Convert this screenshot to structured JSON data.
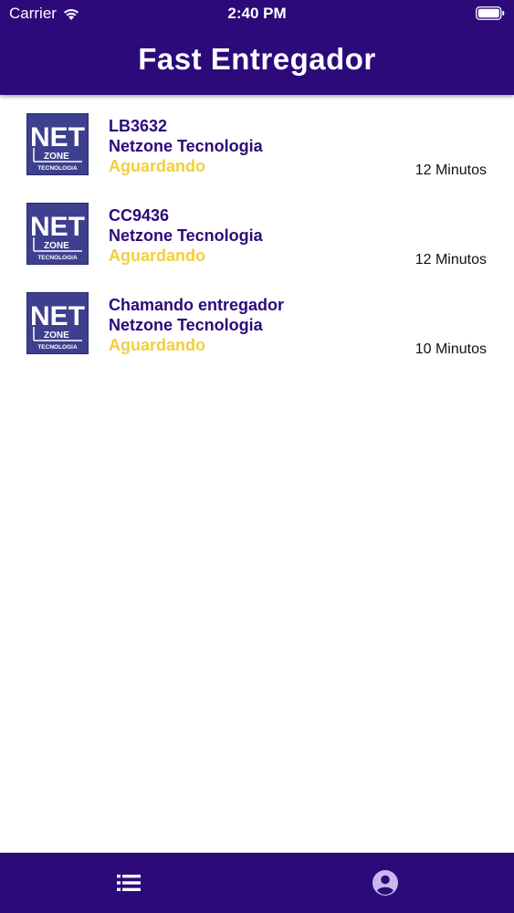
{
  "status_bar": {
    "carrier": "Carrier",
    "time": "2:40 PM"
  },
  "header": {
    "title": "Fast Entregador"
  },
  "orders": [
    {
      "code": "LB3632",
      "company": "Netzone Tecnologia",
      "status": "Aguardando",
      "time": "12 Minutos",
      "logo": {
        "top": "NET",
        "middle": "ZONE",
        "bottom": "TECNOLOGIA"
      }
    },
    {
      "code": "CC9436",
      "company": "Netzone Tecnologia",
      "status": "Aguardando",
      "time": "12 Minutos",
      "logo": {
        "top": "NET",
        "middle": "ZONE",
        "bottom": "TECNOLOGIA"
      }
    },
    {
      "code": "Chamando entregador",
      "company": "Netzone Tecnologia",
      "status": "Aguardando",
      "time": "10 Minutos",
      "logo": {
        "top": "NET",
        "middle": "ZONE",
        "bottom": "TECNOLOGIA"
      }
    }
  ],
  "tab_bar": {
    "items": [
      {
        "icon": "list-icon",
        "active": true
      },
      {
        "icon": "account-circle-icon",
        "active": false
      }
    ]
  },
  "colors": {
    "primary": "#2c0a7a",
    "status_waiting": "#f2cf3c",
    "logo_bg": "#3d3f8f",
    "tab_active": "#ffffff",
    "tab_inactive": "#c9b8ee"
  }
}
